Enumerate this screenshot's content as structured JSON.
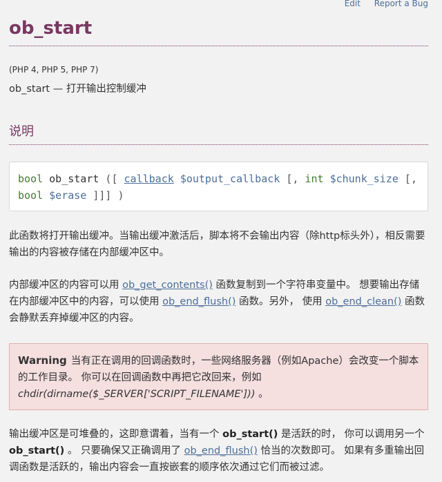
{
  "top_links": {
    "edit": "Edit",
    "report": "Report a Bug"
  },
  "title": "ob_start",
  "versions": "(PHP 4, PHP 5, PHP 7)",
  "refpurpose": "ob_start — 打开输出控制缓冲",
  "section_title": "说明",
  "synopsis": {
    "ret_type": "bool",
    "fn_name": "ob_start",
    "open": " ([ ",
    "cb": "callback",
    "var1": "$output_callback",
    "sep1": " [, ",
    "type2": "int",
    "var2": "$chunk_size",
    "sep2": " [, ",
    "type3": "bool",
    "var3": "$erase",
    "close": " ]]] )"
  },
  "p1": "此函数将打开输出缓冲。当输出缓冲激活后，脚本将不会输出内容（除http标头外），相反需要输出的内容被存储在内部缓冲区中。",
  "p2": {
    "t1": "内部缓冲区的内容可以用 ",
    "l1": "ob_get_contents()",
    "t2": " 函数复制到一个字符串变量中。 想要输出存储在内部缓冲区中的内容，可以使用 ",
    "l2": "ob_end_flush()",
    "t3": " 函数。另外， 使用 ",
    "l3": "ob_end_clean()",
    "t4": " 函数会静默丢弃掉缓冲区的内容。"
  },
  "warning": {
    "title": "Warning",
    "t1": "当有正在调用的回调函数时，一些网络服务器（例如Apache）会改变一个脚本的工作目录。 你可以在回调函数中再把它改回来，例如 ",
    "code": "chdir(dirname($_SERVER['SCRIPT_FILENAME']))",
    "t2": " 。"
  },
  "p4": {
    "t1": "输出缓冲区是可堆叠的，这即意谓着，当有一个 ",
    "b1": "ob_start()",
    "t2": " 是活跃的时， 你可以调用另一个 ",
    "b2": "ob_start()",
    "t3": " 。 只要确保又正确调用了 ",
    "l1": "ob_end_flush()",
    "t4": " 恰当的次数即可。 如果有多重输出回调函数是活跃的，输出内容会一直按嵌套的顺序依次通过它们而被过滤。"
  }
}
